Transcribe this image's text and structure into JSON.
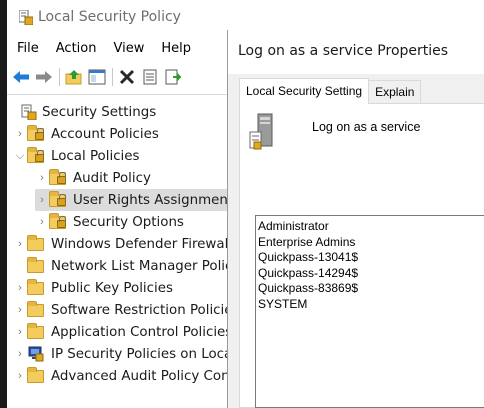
{
  "window": {
    "title": "Local Security Policy",
    "menu": [
      "File",
      "Action",
      "View",
      "Help"
    ]
  },
  "toolbar": {
    "buttons": [
      "back-arrow-icon",
      "forward-arrow-icon",
      "up-folder-icon",
      "show-hide-tree-icon",
      "delete-icon",
      "properties-icon",
      "export-list-icon"
    ]
  },
  "tree": {
    "root": "Security Settings",
    "items": [
      {
        "label": "Account Policies",
        "expander": "collapsed",
        "depth": 1,
        "icon": "folder-lock-icon"
      },
      {
        "label": "Local Policies",
        "expander": "expanded",
        "depth": 1,
        "icon": "folder-lock-icon"
      },
      {
        "label": "Audit Policy",
        "expander": "collapsed",
        "depth": 2,
        "icon": "folder-lock-icon"
      },
      {
        "label": "User Rights Assignment",
        "expander": "collapsed",
        "depth": 2,
        "icon": "folder-lock-icon",
        "selected": true
      },
      {
        "label": "Security Options",
        "expander": "collapsed",
        "depth": 2,
        "icon": "folder-lock-icon"
      },
      {
        "label": "Windows Defender Firewall",
        "expander": "collapsed",
        "depth": 1,
        "icon": "folder-icon"
      },
      {
        "label": "Network List Manager Polic",
        "expander": "none",
        "depth": 1,
        "icon": "folder-icon"
      },
      {
        "label": "Public Key Policies",
        "expander": "collapsed",
        "depth": 1,
        "icon": "folder-icon"
      },
      {
        "label": "Software Restriction Policie",
        "expander": "collapsed",
        "depth": 1,
        "icon": "folder-icon"
      },
      {
        "label": "Application Control Policies",
        "expander": "collapsed",
        "depth": 1,
        "icon": "folder-icon"
      },
      {
        "label": "IP Security Policies on Local",
        "expander": "collapsed",
        "depth": 1,
        "icon": "ip-security-icon"
      },
      {
        "label": "Advanced Audit Policy Con",
        "expander": "collapsed",
        "depth": 1,
        "icon": "folder-icon"
      }
    ]
  },
  "dialog": {
    "title": "Log on as a service Properties",
    "tabs": [
      "Local Security Setting",
      "Explain"
    ],
    "active_tab": "Local Security Setting",
    "policy_name": "Log on as a service",
    "accounts": [
      "Administrator",
      "Enterprise Admins",
      "Quickpass-13041$",
      "Quickpass-14294$",
      "Quickpass-83869$",
      "SYSTEM"
    ]
  },
  "colors": {
    "folder": "#f4cc5e",
    "selection": "#dcdcdc",
    "dialog_body": "#f0f0f0",
    "back_arrow": "#1e7bd6"
  }
}
